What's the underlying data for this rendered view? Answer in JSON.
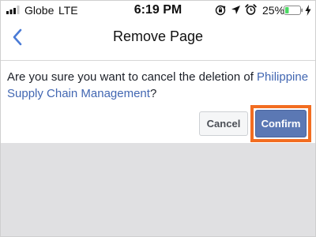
{
  "status_bar": {
    "carrier": "Globe",
    "network": "LTE",
    "time": "6:19 PM",
    "battery_percent": "25%",
    "battery_level": 0.25,
    "icons": [
      "signal-bars-icon",
      "rotation-lock-icon",
      "location-arrow-icon",
      "alarm-clock-icon",
      "battery-icon",
      "charging-bolt-icon"
    ]
  },
  "nav": {
    "title": "Remove Page",
    "back_icon": "chevron-left-icon"
  },
  "dialog": {
    "message_prefix": "Are you sure you want to cancel the deletion of ",
    "page_name": "Philippine Supply Chain Management",
    "message_suffix": "?",
    "cancel_label": "Cancel",
    "confirm_label": "Confirm"
  },
  "colors": {
    "accent_blue": "#4267b2",
    "confirm_bg": "#5b78b4",
    "highlight_orange": "#f26d21",
    "battery_fill": "#4cd964",
    "backdrop": "#e0e0e2"
  }
}
